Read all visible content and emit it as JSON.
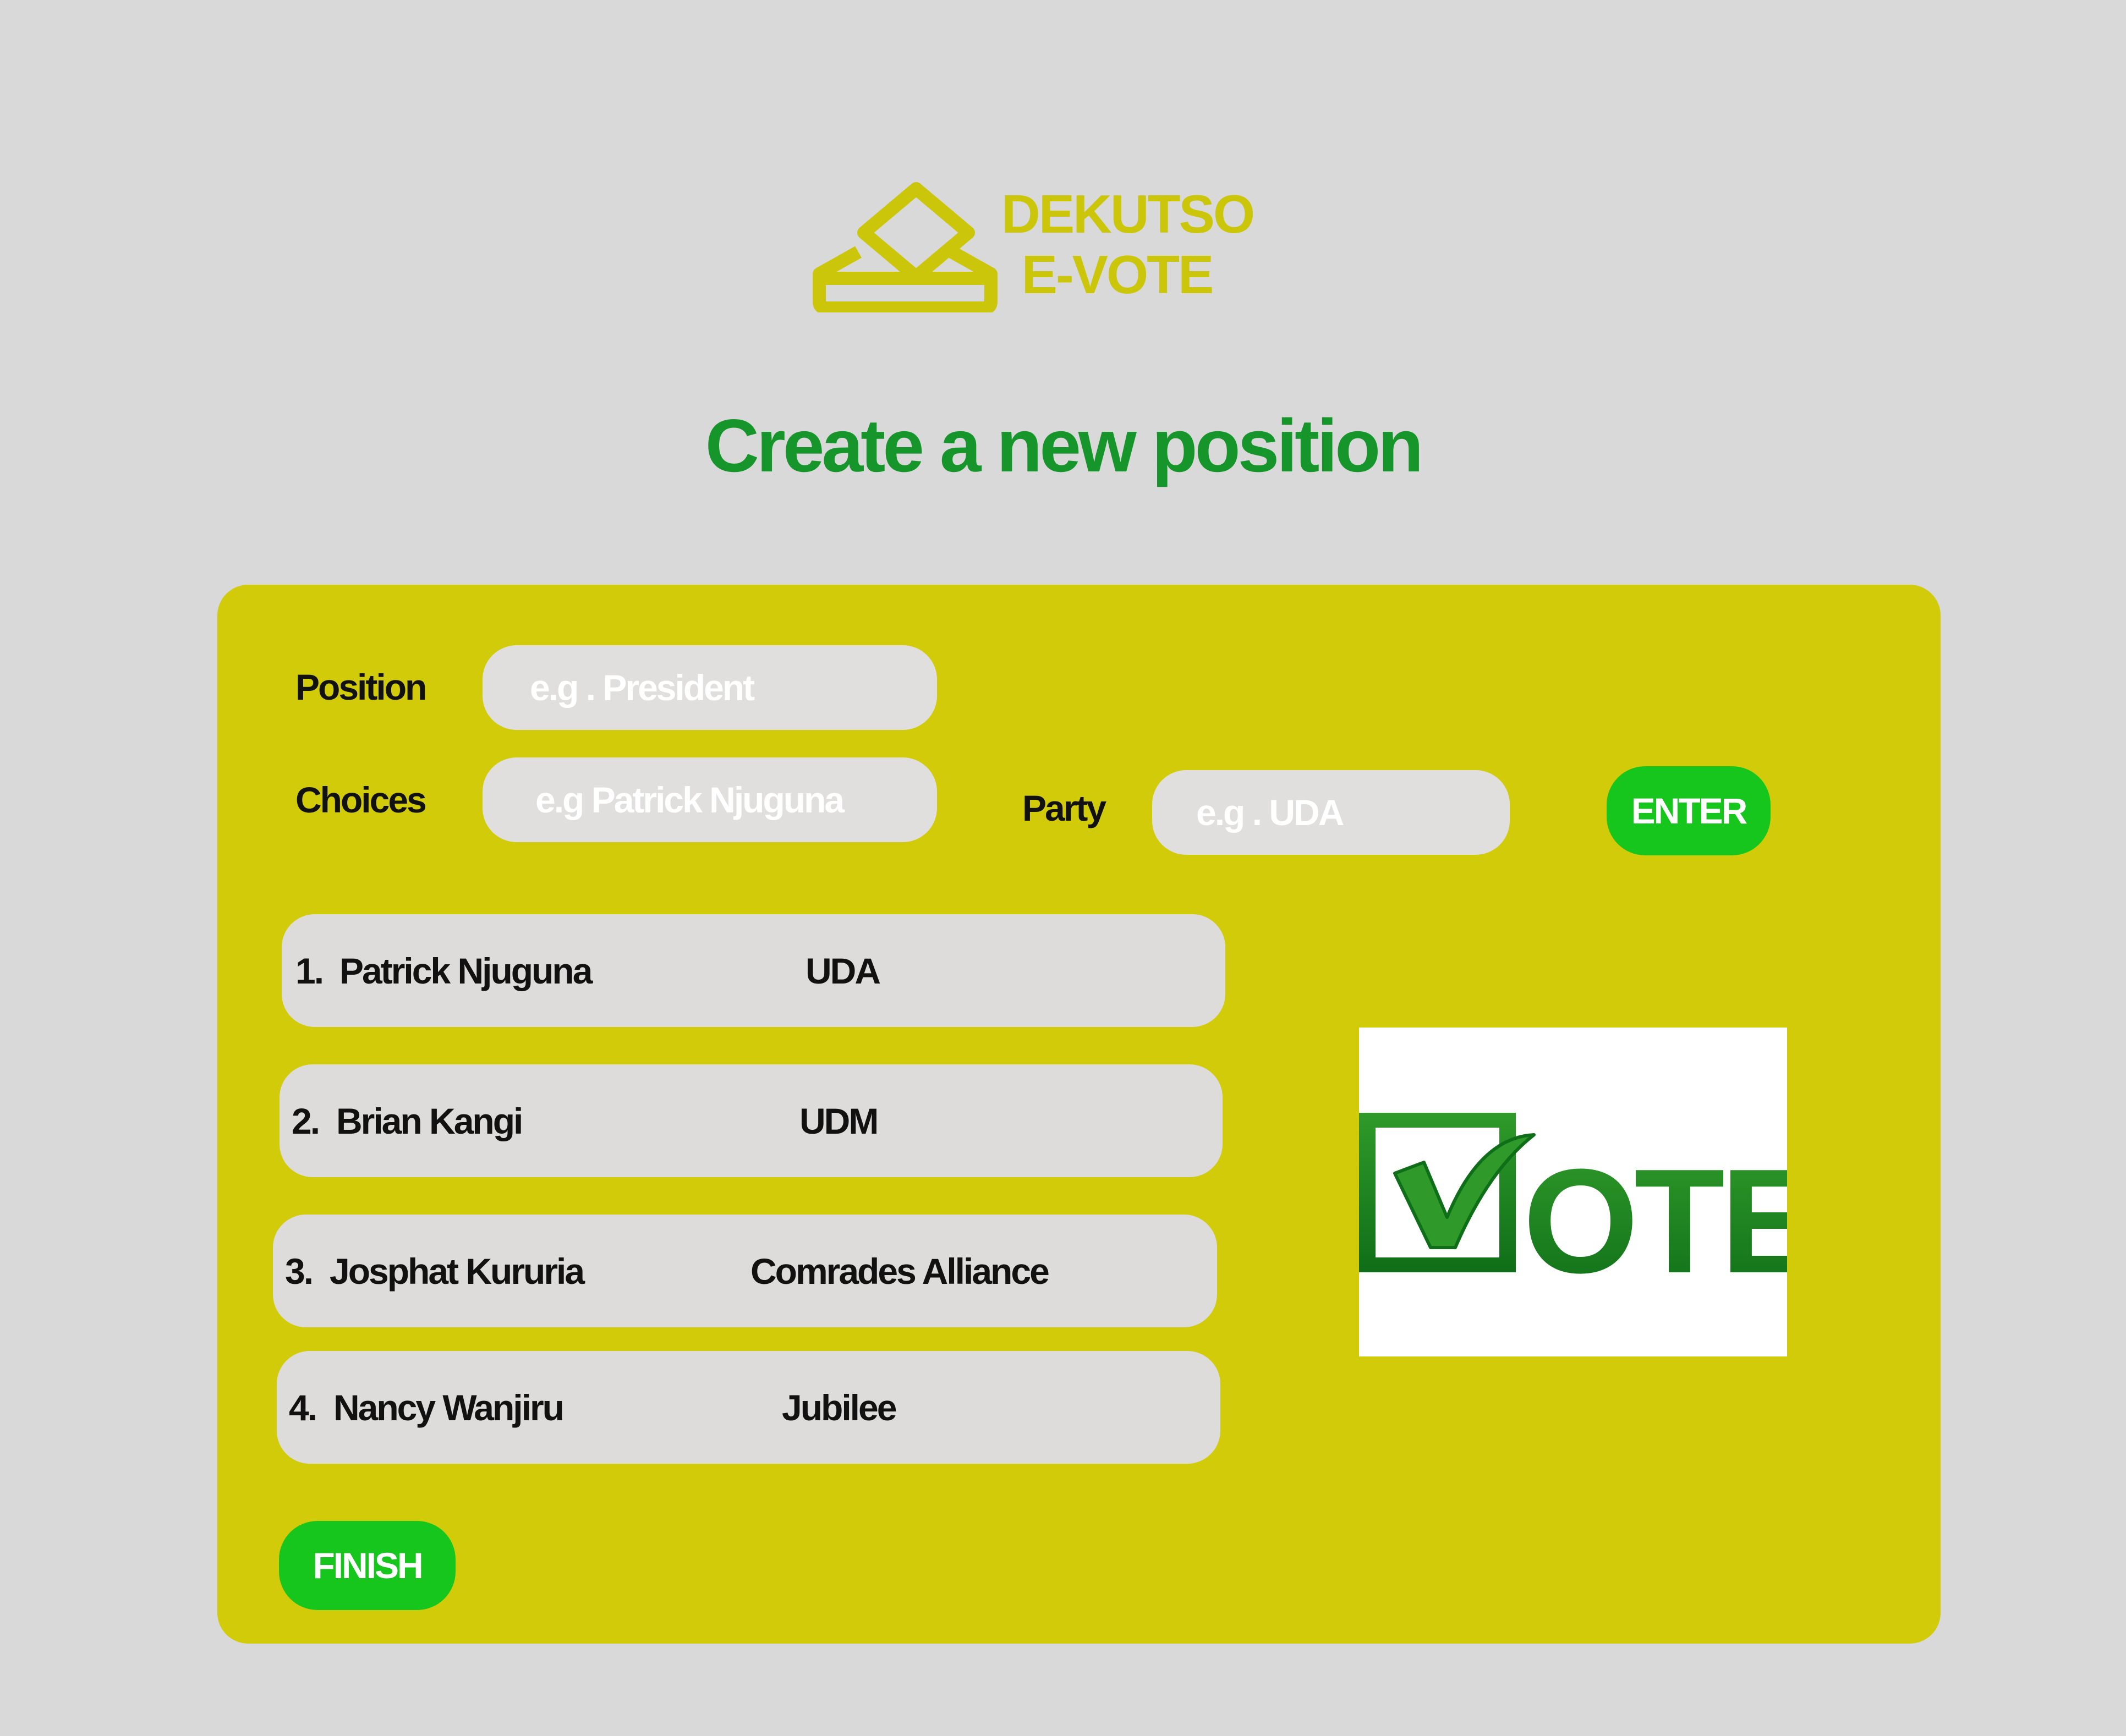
{
  "brand": {
    "line1": "DEKUTSO",
    "line2": "E-VOTE",
    "icon": "ballot-box-icon",
    "color": "#cbc60a"
  },
  "page": {
    "title": "Create a new position",
    "title_color": "#16962a",
    "background": "#d9d9d9"
  },
  "form": {
    "card_color": "#d2cb09",
    "position_label": "Position",
    "position_placeholder": "e.g . President",
    "choices_label": "Choices",
    "choices_placeholder": "e.g Patrick Njuguna",
    "party_label": "Party",
    "party_placeholder": "e.g . UDA",
    "enter_label": "ENTER",
    "finish_label": "FINISH",
    "button_color": "#16c61c"
  },
  "choices": [
    {
      "number": "1.",
      "name": "Patrick Njuguna",
      "party": "UDA"
    },
    {
      "number": "2.",
      "name": "Brian Kangi",
      "party": "UDM"
    },
    {
      "number": "3.",
      "name": "Josphat Kururia",
      "party": "Comrades Alliance"
    },
    {
      "number": "4.",
      "name": "Nancy Wanjiru",
      "party": "Jubilee"
    }
  ],
  "vote_image": {
    "text": "VOTE",
    "icon": "checkbox-check-icon"
  }
}
